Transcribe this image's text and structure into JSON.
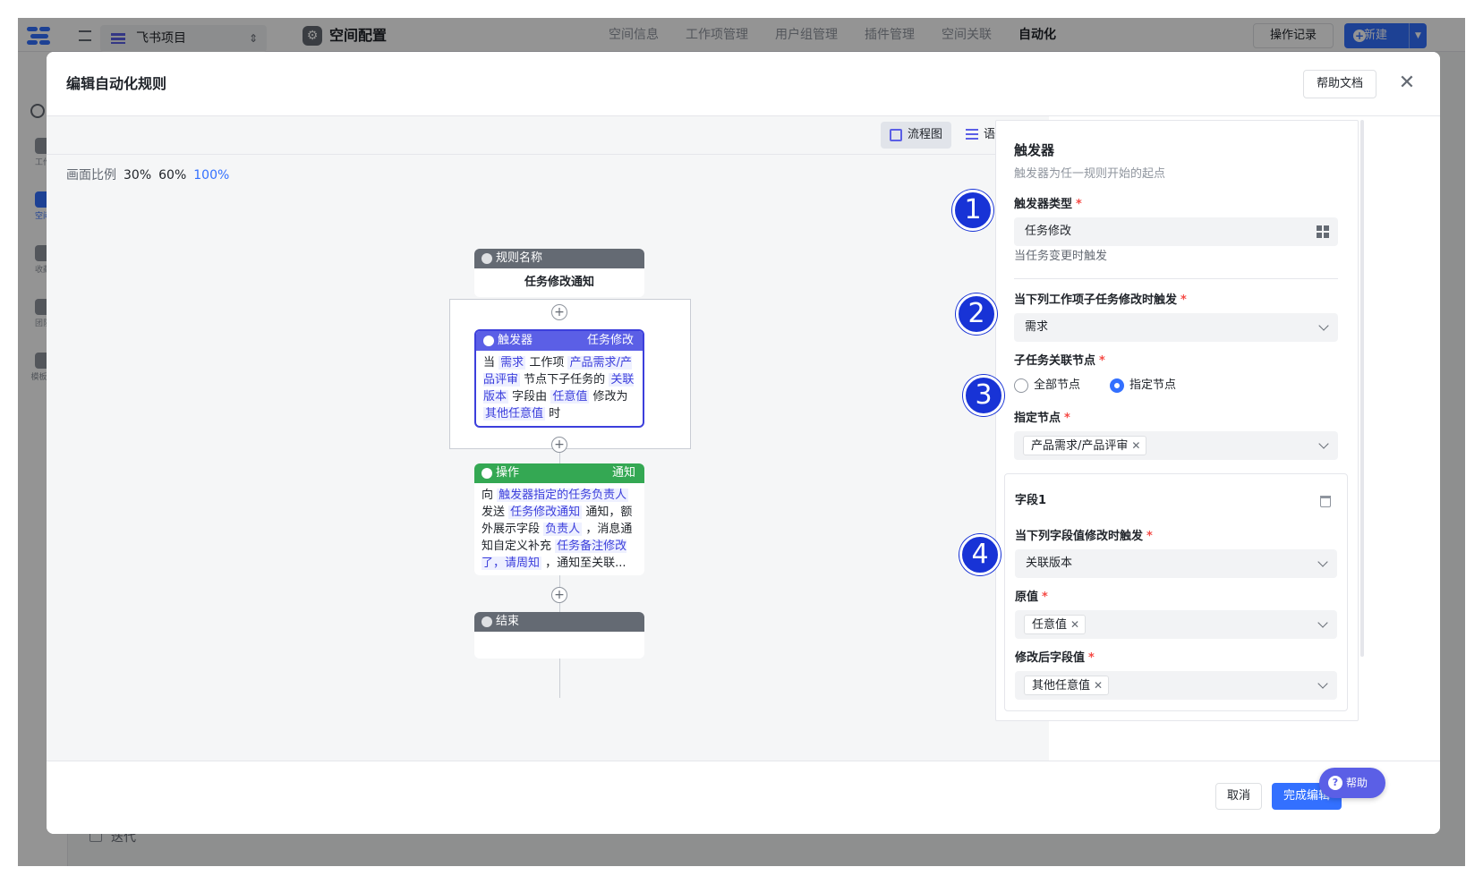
{
  "app": {
    "project_name": "飞书项目",
    "settings_title": "空间配置",
    "nav_tabs": [
      "空间信息",
      "工作项管理",
      "用户组管理",
      "插件管理",
      "空间关联",
      "自动化"
    ],
    "active_tab": "自动化",
    "op_log_label": "操作记录",
    "new_label": "新建",
    "sidebar_items": [
      "工作",
      "空间",
      "收藏",
      "团队",
      "模板中"
    ],
    "iteration_label": "迭代"
  },
  "modal": {
    "title": "编辑自动化规则",
    "help_doc_label": "帮助文档",
    "close_glyph": "✕",
    "view_flow_label": "流程图",
    "view_semantic_label": "语义化",
    "zoom_label": "画面比例",
    "zoom_options": [
      "30%",
      "60%",
      "100%"
    ],
    "zoom_active": "100%",
    "cancel_label": "取消",
    "finish_label": "完成编辑",
    "help_float_label": "帮助"
  },
  "flow": {
    "rule_node": {
      "header": "规则名称",
      "body": "任务修改通知"
    },
    "trigger_node": {
      "header": "触发器",
      "tag": "任务修改",
      "t1": "当",
      "h1": "需求",
      "t2": "工作项",
      "h2": "产品需求/产品评审",
      "t3": "节点下子任务的",
      "h3": "关联版本",
      "t4": "字段由",
      "h4": "任意值",
      "t5": "修改为",
      "h5": "其他任意值",
      "t6": "时"
    },
    "op_node": {
      "header": "操作",
      "tag": "通知",
      "t1": "向",
      "h1": "触发器指定的任务负责人",
      "t2": "发送",
      "h2": "任务修改通知",
      "t3": "通知，额外展示字段",
      "h3": "负责人",
      "t4": "，消息通知自定义补充",
      "h4": "任务备注修改了，请周知",
      "t5": "，通知至关联..."
    },
    "end_node": {
      "header": "结束"
    },
    "add_glyph": "+"
  },
  "config": {
    "title": "触发器",
    "desc": "触发器为任一规则开始的起点",
    "trigger_type_label": "触发器类型",
    "trigger_type_value": "任务修改",
    "trigger_type_hint": "当任务变更时触发",
    "workitem_label": "当下列工作项子任务修改时触发",
    "workitem_value": "需求",
    "node_scope_label": "子任务关联节点",
    "radio_all": "全部节点",
    "radio_specified": "指定节点",
    "radio_selected": "指定节点",
    "specified_node_label": "指定节点",
    "specified_node_tag": "产品需求/产品评审",
    "field_card": {
      "title": "字段1",
      "field_label": "当下列字段值修改时触发",
      "field_value": "关联版本",
      "old_label": "原值",
      "old_tag": "任意值",
      "new_label": "修改后字段值",
      "new_tag": "其他任意值"
    },
    "required_mark": "*",
    "tag_close": "✕"
  },
  "badges": [
    "1",
    "2",
    "3",
    "4"
  ],
  "colors": {
    "accent": "#3370ff",
    "trigger": "#5b5fe6",
    "operation": "#34a853",
    "badge": "#1833d6",
    "required": "#f54a45"
  }
}
